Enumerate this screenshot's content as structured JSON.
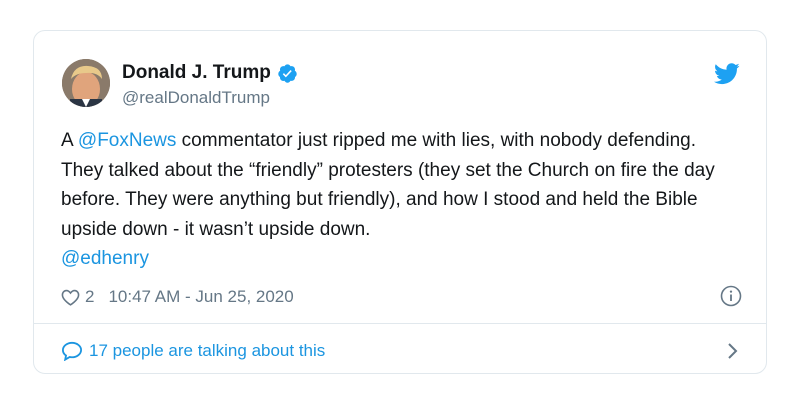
{
  "tweet": {
    "display_name": "Donald J. Trump",
    "handle": "@realDonaldTrump",
    "text_segments": [
      {
        "type": "mention",
        "text": "@FoxNews"
      },
      {
        "type": "text",
        "text": " commentator just ripped me with lies, with nobody defending. They talked about the “friendly” protesters (they set the Church on fire the day before. They were anything but friendly), and how I stood and held the Bible upside down - it wasn’t upside down. "
      },
      {
        "type": "mention",
        "text": "@edhenry"
      }
    ],
    "text_prefix": "A ",
    "mention_1": "@FoxNews",
    "body_main": " commentator just ripped me with lies, with nobody defending. They talked about the “friendly” protesters (they set the Church on fire the day before. They were anything but friendly), and how I stood and held the Bible upside down - it wasn’t upside down.",
    "mention_2": "@edhenry",
    "like_count": "2",
    "timestamp": "10:47 AM - Jun 25, 2020",
    "talking_text": "17 people are talking about this"
  },
  "colors": {
    "link": "#1b95e0",
    "verified": "#1da1f2",
    "muted": "#657786",
    "text": "#14171a",
    "border": "#e1e8ed"
  },
  "icons": {
    "verified": "verified-badge-icon",
    "bird": "twitter-bird-icon",
    "heart": "heart-icon",
    "info": "info-icon",
    "reply": "reply-bubble-icon",
    "chevron": "chevron-right-icon"
  }
}
